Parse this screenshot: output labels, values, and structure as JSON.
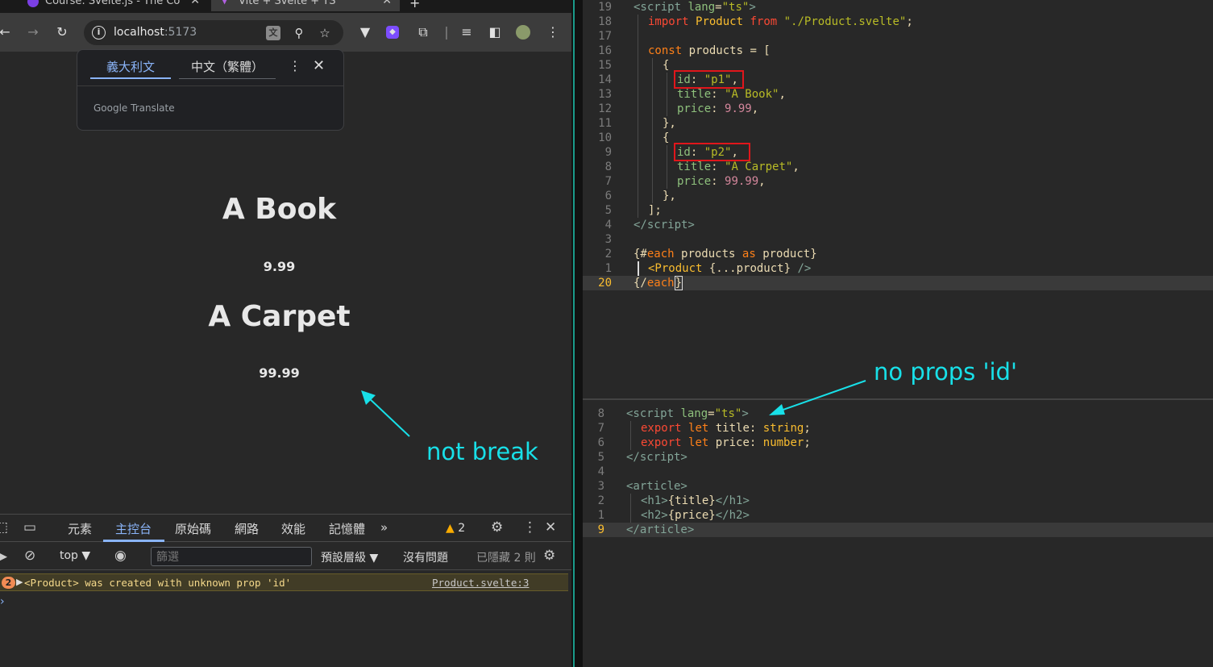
{
  "browser": {
    "tabs": [
      {
        "label": "Course: Svelte.js - The Co"
      },
      {
        "label": "Vite + Svelte + TS"
      }
    ],
    "url_host": "localhost",
    "url_port": ":5173",
    "translate_popup": {
      "tab_source": "義大利文",
      "tab_target": "中文（繁體）",
      "brand": "Google Translate"
    },
    "products": [
      {
        "title": "A Book",
        "price": "9.99"
      },
      {
        "title": "A Carpet",
        "price": "99.99"
      }
    ],
    "annotation": "not break"
  },
  "devtools": {
    "tabs": [
      "元素",
      "主控台",
      "原始碼",
      "網路",
      "效能",
      "記憶體"
    ],
    "more": "»",
    "warning_count": "2",
    "context": "top",
    "filter_placeholder": "篩選",
    "levels": "預設層級",
    "issues": "沒有問題",
    "hidden": "已隱藏 2 則",
    "message": {
      "count": "2",
      "text": "<Product> was created with unknown prop 'id'",
      "source": "Product.svelte:3"
    }
  },
  "editor": {
    "annotation": "no props 'id'"
  },
  "colors": {
    "annotation": "#18e0e8",
    "highlight_box": "#e0161b",
    "accent": "#8ab4f8"
  }
}
